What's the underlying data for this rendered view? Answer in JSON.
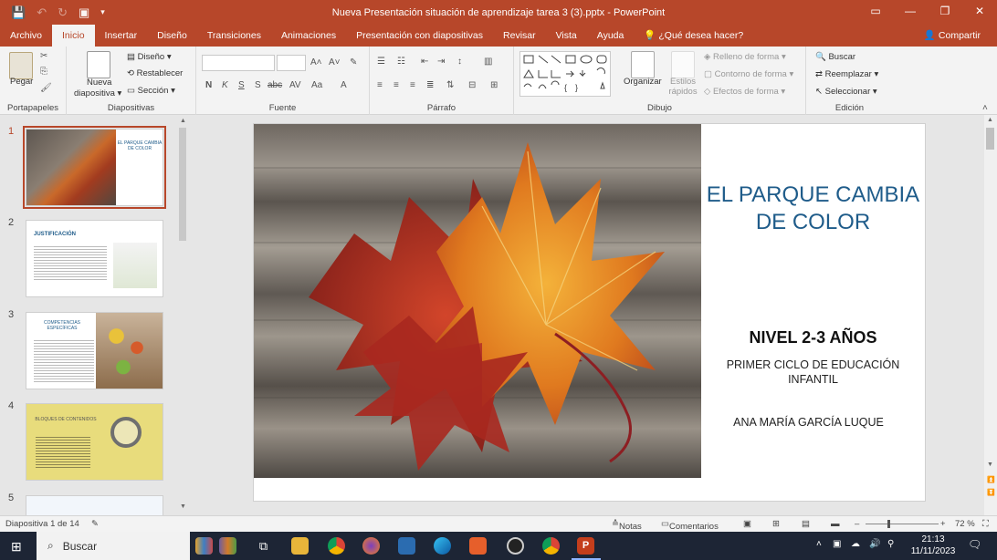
{
  "window": {
    "title": "Nueva Presentación situación de aprendizaje tarea 3 (3).pptx  -  PowerPoint",
    "controls": [
      "▭",
      "—",
      "❐",
      "✕"
    ]
  },
  "tabs": [
    "Archivo",
    "Inicio",
    "Insertar",
    "Diseño",
    "Transiciones",
    "Animaciones",
    "Presentación con diapositivas",
    "Revisar",
    "Vista",
    "Ayuda",
    "¿Qué desea hacer?"
  ],
  "share_label": "Compartir",
  "ribbon": {
    "portapapeles": {
      "label": "Portapapeles",
      "paste": "Pegar"
    },
    "diapositivas": {
      "label": "Diapositivas",
      "new_slide": "Nueva diapositiva",
      "layout": "Diseño",
      "reset": "Restablecer",
      "section": "Sección"
    },
    "fuente": {
      "label": "Fuente",
      "bold": "N",
      "italic": "K",
      "underline": "S",
      "strike": "abc",
      "font_color": "A"
    },
    "parrafo": {
      "label": "Párrafo"
    },
    "dibujo": {
      "label": "Dibujo",
      "arrange": "Organizar",
      "styles": "Estilos rápidos",
      "fill": "Relleno de forma",
      "outline": "Contorno de forma",
      "effects": "Efectos de forma"
    },
    "edicion": {
      "label": "Edición",
      "find": "Buscar",
      "replace": "Reemplazar",
      "select": "Seleccionar"
    }
  },
  "thumbnails": [
    {
      "num": "1",
      "title": "EL PARQUE CAMBIA DE COLOR"
    },
    {
      "num": "2",
      "title": "JUSTIFICACIÓN"
    },
    {
      "num": "3",
      "title": "COMPETENCIAS ESPECÍFICAS"
    },
    {
      "num": "4",
      "title": "BLOQUES DE CONTENIDOS"
    },
    {
      "num": "5",
      "title": ""
    }
  ],
  "slide": {
    "title": "EL PARQUE CAMBIA DE COLOR",
    "level": "NIVEL 2-3 AÑOS",
    "cycle": "PRIMER CICLO DE EDUCACIÓN INFANTIL",
    "author": "ANA MARÍA GARCÍA LUQUE"
  },
  "status": {
    "slide_count": "Diapositiva 1 de 14",
    "notes": "Notas",
    "comments": "Comentarios",
    "zoom": "72 %"
  },
  "taskbar": {
    "search": "Buscar",
    "time": "21:13",
    "date": "11/11/2023"
  },
  "colors": {
    "accent": "#b7472a",
    "title_blue": "#1f5c8a"
  }
}
